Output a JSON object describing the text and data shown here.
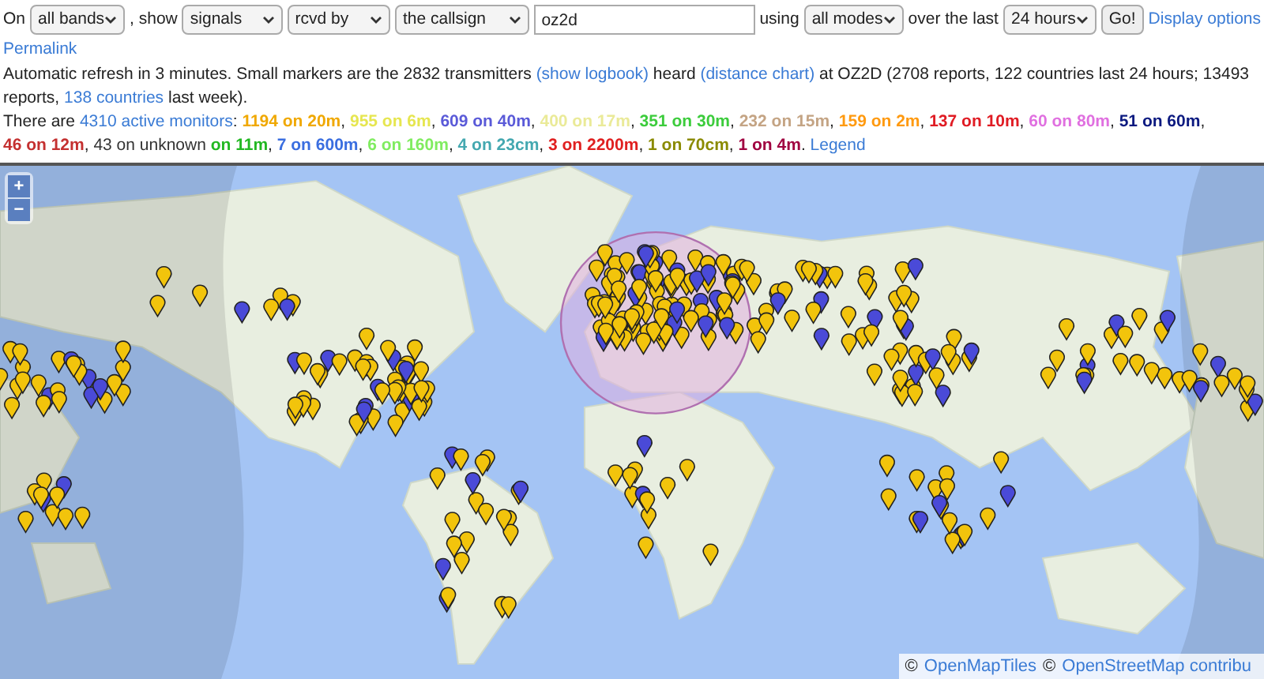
{
  "form": {
    "prefix": "On",
    "band": "all bands",
    "show_label": ", show",
    "show": "signals",
    "direction": "rcvd by",
    "target": "the callsign",
    "callsign": "oz2d",
    "using_label": "using",
    "mode": "all modes",
    "period_label": "over the last",
    "period": "24 hours",
    "go": "Go!",
    "display_options": "Display options"
  },
  "permalink": "Permalink",
  "summary": [
    {
      "kind": "text",
      "text": "Automatic refresh in 3 minutes. Small markers are the 2832 transmitters "
    },
    {
      "kind": "link",
      "text": "(show logbook)"
    },
    {
      "kind": "text",
      "text": " heard "
    },
    {
      "kind": "link",
      "text": "(distance chart)"
    },
    {
      "kind": "text",
      "text": " at OZ2D (2708 reports, 122 countries last 24 hours; 13493 reports, "
    },
    {
      "kind": "link",
      "text": "138 countries"
    },
    {
      "kind": "text",
      "text": " last week)."
    }
  ],
  "monitors": {
    "prefix": "There are",
    "link": "4310 active monitors",
    "colon": ":",
    "bands": [
      {
        "text": "1194 on 20m",
        "color": "#f0a800",
        "bold": true,
        "sep": ","
      },
      {
        "text": "955 on 6m",
        "color": "#e6e650",
        "bold": true,
        "sep": ","
      },
      {
        "text": "609 on 40m",
        "color": "#5a5ad8",
        "bold": true,
        "sep": ","
      },
      {
        "text": "400 on 17m",
        "color": "#eaea98",
        "bold": true,
        "sep": ","
      },
      {
        "text": "351 on 30m",
        "color": "#3ccc3c",
        "bold": true,
        "sep": ","
      },
      {
        "text": "232 on 15m",
        "color": "#c4a484",
        "bold": true,
        "sep": ","
      },
      {
        "text": "159 on 2m",
        "color": "#ff9a10",
        "bold": true,
        "sep": ","
      },
      {
        "text": "137 on 10m",
        "color": "#e01c24",
        "bold": true,
        "sep": ","
      },
      {
        "text": "60 on 80m",
        "color": "#e070e0",
        "bold": true,
        "sep": ","
      },
      {
        "text": "51 on 60m",
        "color": "#0c1a80",
        "bold": true,
        "sep": ","
      },
      {
        "text": "46 on 12m",
        "color": "#c43030",
        "bold": true,
        "sep": ","
      },
      {
        "text": "43 on unknown",
        "color": "#333333",
        "bold": false
      },
      {
        "text": "on 11m",
        "color": "#22b822",
        "bold": true,
        "sep": ","
      },
      {
        "text": "7 on 600m",
        "color": "#3a6ee0",
        "bold": true,
        "sep": ","
      },
      {
        "text": "6 on 160m",
        "color": "#80ec60",
        "bold": true,
        "sep": ","
      },
      {
        "text": "4 on 23cm",
        "color": "#44a8b0",
        "bold": true,
        "sep": ","
      },
      {
        "text": "3 on 2200m",
        "color": "#e02020",
        "bold": true,
        "sep": ","
      },
      {
        "text": "1 on 70cm",
        "color": "#8a8a00",
        "bold": true,
        "sep": ","
      },
      {
        "text": "1 on 4m",
        "color": "#a00040",
        "bold": true,
        "sep": "."
      }
    ],
    "legend": "Legend"
  },
  "map": {
    "zoom_in": "+",
    "zoom_out": "−",
    "attribution": [
      {
        "text": "©",
        "kind": "text"
      },
      {
        "text": "OpenMapTiles",
        "kind": "link"
      },
      {
        "text": "©",
        "kind": "text"
      },
      {
        "text": "OpenStreetMap contribu",
        "kind": "link"
      }
    ]
  }
}
